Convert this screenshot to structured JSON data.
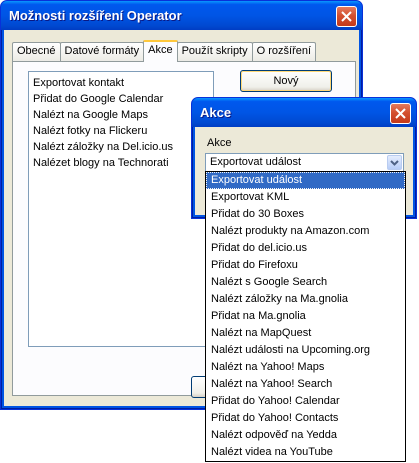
{
  "main_window": {
    "title": "Možnosti rozšíření Operator",
    "tabs": [
      {
        "label": "Obecné"
      },
      {
        "label": "Datové formáty"
      },
      {
        "label": "Akce"
      },
      {
        "label": "Použít skripty"
      },
      {
        "label": "O rozšíření"
      }
    ],
    "active_tab": "Akce",
    "actions_list": [
      "Exportovat kontakt",
      "Přidat do Google Calendar",
      "Nalézt na Google Maps",
      "Nalézt fotky na Flickeru",
      "Nalézt záložky na Del.icio.us",
      "Nalézet blogy na Technorati"
    ],
    "new_button": "Nový"
  },
  "dialog": {
    "title": "Akce",
    "field_label": "Akce",
    "combo_value": "Exportovat událost"
  },
  "dropdown": {
    "selected_index": 0,
    "options": [
      "Exportovat událost",
      "Exportovat KML",
      "Přidat do 30 Boxes",
      "Nalézt produkty na Amazon.com",
      "Přidat do del.icio.us",
      "Přidat do Firefoxu",
      "Nalézt s Google Search",
      "Nalézt záložky na Ma.gnolia",
      "Přidat na Ma.gnolia",
      "Nalézt na MapQuest",
      "Nalézt události na Upcoming.org",
      "Nalézt na Yahoo! Maps",
      "Nalézt na Yahoo! Search",
      "Přidat do Yahoo! Calendar",
      "Přidat do Yahoo! Contacts",
      "Nalézt odpověď na Yedda",
      "Nalézt videa na YouTube"
    ]
  },
  "colors": {
    "titlebar": "#0055e5",
    "selection": "#316ac5",
    "close_button": "#d45030",
    "dialog_face": "#ece9d8"
  }
}
